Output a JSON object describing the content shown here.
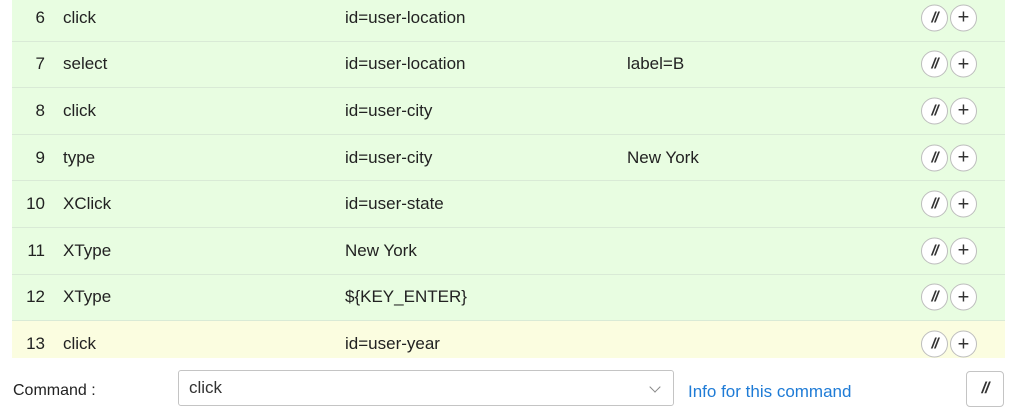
{
  "rows": [
    {
      "index": "6",
      "command": "click",
      "target": "id=user-location",
      "value": "",
      "comment_label": "//",
      "add_label": "+"
    },
    {
      "index": "7",
      "command": "select",
      "target": "id=user-location",
      "value": "label=B",
      "comment_label": "//",
      "add_label": "+"
    },
    {
      "index": "8",
      "command": "click",
      "target": "id=user-city",
      "value": "",
      "comment_label": "//",
      "add_label": "+"
    },
    {
      "index": "9",
      "command": "type",
      "target": "id=user-city",
      "value": "New York",
      "comment_label": "//",
      "add_label": "+"
    },
    {
      "index": "10",
      "command": "XClick",
      "target": "id=user-state",
      "value": "",
      "comment_label": "//",
      "add_label": "+"
    },
    {
      "index": "11",
      "command": "XType",
      "target": "New York",
      "value": "",
      "comment_label": "//",
      "add_label": "+"
    },
    {
      "index": "12",
      "command": "XType",
      "target": "${KEY_ENTER}",
      "value": "",
      "comment_label": "//",
      "add_label": "+"
    },
    {
      "index": "13",
      "command": "click",
      "target": "id=user-year",
      "value": "",
      "comment_label": "//",
      "add_label": "+"
    }
  ],
  "editor": {
    "command_label": "Command :",
    "command_value": "click",
    "info_link": "Info for this command",
    "comment_button": "//"
  },
  "colors": {
    "row_background": "#e8fde1",
    "current_row_background": "#fbfde0",
    "link": "#1e7bd6"
  }
}
